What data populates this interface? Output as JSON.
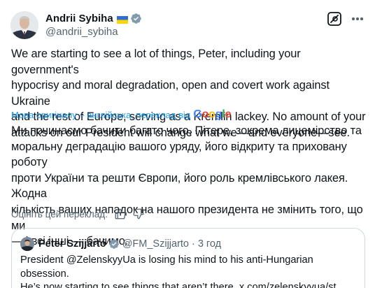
{
  "post": {
    "author": {
      "name": "Andrii Sybiha",
      "flag_icon": "ukraine-flag-icon",
      "verified_icon": "verified-badge-icon",
      "handle": "@andrii_sybiha"
    },
    "text": "We are starting to see a lot of things, Peter, including your government's\nhypocrisy and moral degradation, open and covert work against Ukraine\nand the rest of Europe, serving as a Kremlin lackey. No amount of your\nattacks on our President will change what we—and everyone—see.",
    "translation": {
      "label": "Мова оригіналу – англійська, переклад від",
      "provider": "Google",
      "text": "Ми починаємо бачити багато чого, Пітере, зокрема лицемірство та\nморальну деградацію вашого уряду, його відкриту та приховану роботу\nпроти України та решти Європи, його роль кремлівського лакея. Жодна\nкількість ваших нападок на нашого президента не змінить того, що ми\n— і всі інші — бачимо.",
      "rate_label": "Оцініть цей переклад:"
    },
    "quote": {
      "name": "Péter Szijjártó",
      "handle": "@FM_Szijjarto",
      "separator": "·",
      "time": "3 год",
      "text": "President @ZelenskyyUa is losing his mind to his anti-Hungarian obsession.\nHe’s now starting to see things that aren’t there. x.com/zelenskyyua/st..."
    }
  },
  "colors": {
    "text": "#0f1419",
    "secondary": "#536471",
    "link": "#1d9bf0",
    "verified": "#829aab",
    "border": "#cfd9de"
  }
}
